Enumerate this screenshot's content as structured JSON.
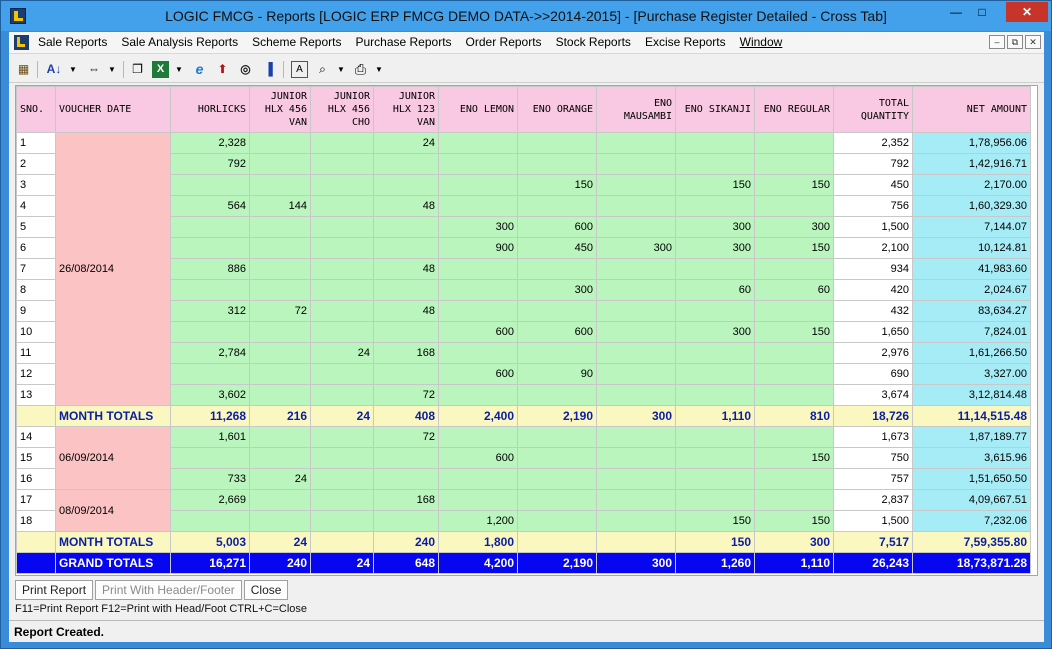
{
  "window": {
    "title": "LOGIC FMCG - Reports  [LOGIC ERP FMCG DEMO DATA->>2014-2015] - [Purchase Register Detailed - Cross Tab]",
    "min_glyph": "—",
    "max_glyph": "□",
    "close_glyph": "✕"
  },
  "menu": {
    "items": [
      "Sale Reports",
      "Sale Analysis Reports",
      "Scheme Reports",
      "Purchase Reports",
      "Order Reports",
      "Stock Reports",
      "Excise Reports",
      "Window"
    ],
    "mdi_min": "–",
    "mdi_restore": "⧉",
    "mdi_close": "✕"
  },
  "toolbar": {
    "icons": [
      "calendar-icon",
      "sort-icon",
      "column-width-icon",
      "copy-icon",
      "excel-icon",
      "internet-explorer-icon",
      "upload-arrow-icon",
      "binoculars-icon",
      "chart-icon",
      "font-icon",
      "print-preview-icon",
      "printer-icon"
    ],
    "glyphs": {
      "calendar": "▦",
      "sort": "A↓",
      "width": "⇔",
      "copy": "❐",
      "excel": "X",
      "ie": "e",
      "arrow": "⬆",
      "binoculars": "◎",
      "chart": "▐",
      "font": "A",
      "preview": "⌕",
      "printer": "⎙",
      "dropdown": "▼"
    }
  },
  "grid": {
    "columns": [
      "SNO.",
      "VOUCHER DATE",
      "HORLICKS",
      "JUNIOR HLX 456 VAN",
      "JUNIOR HLX 456 CHO",
      "JUNIOR HLX 123 VAN",
      "ENO LEMON",
      "ENO ORANGE",
      "ENO MAUSAMBI",
      "ENO SIKANJI",
      "ENO REGULAR",
      "TOTAL QUANTITY",
      "NET AMOUNT"
    ],
    "groups": [
      {
        "date": "26/08/2014",
        "rows": [
          {
            "sno": "1",
            "v": [
              "2,328",
              "",
              "",
              "24",
              "",
              "",
              "",
              "",
              ""
            ],
            "tq": "2,352",
            "na": "1,78,956.06"
          },
          {
            "sno": "2",
            "v": [
              "792",
              "",
              "",
              "",
              "",
              "",
              "",
              "",
              ""
            ],
            "tq": "792",
            "na": "1,42,916.71"
          },
          {
            "sno": "3",
            "v": [
              "",
              "",
              "",
              "",
              "",
              "150",
              "",
              "150",
              "150"
            ],
            "tq": "450",
            "na": "2,170.00"
          },
          {
            "sno": "4",
            "v": [
              "564",
              "144",
              "",
              "48",
              "",
              "",
              "",
              "",
              ""
            ],
            "tq": "756",
            "na": "1,60,329.30"
          },
          {
            "sno": "5",
            "v": [
              "",
              "",
              "",
              "",
              "300",
              "600",
              "",
              "300",
              "300"
            ],
            "tq": "1,500",
            "na": "7,144.07"
          },
          {
            "sno": "6",
            "v": [
              "",
              "",
              "",
              "",
              "900",
              "450",
              "300",
              "300",
              "150"
            ],
            "tq": "2,100",
            "na": "10,124.81"
          },
          {
            "sno": "7",
            "v": [
              "886",
              "",
              "",
              "48",
              "",
              "",
              "",
              "",
              ""
            ],
            "tq": "934",
            "na": "41,983.60"
          },
          {
            "sno": "8",
            "v": [
              "",
              "",
              "",
              "",
              "",
              "300",
              "",
              "60",
              "60"
            ],
            "tq": "420",
            "na": "2,024.67"
          },
          {
            "sno": "9",
            "v": [
              "312",
              "72",
              "",
              "48",
              "",
              "",
              "",
              "",
              ""
            ],
            "tq": "432",
            "na": "83,634.27"
          },
          {
            "sno": "10",
            "v": [
              "",
              "",
              "",
              "",
              "600",
              "600",
              "",
              "300",
              "150"
            ],
            "tq": "1,650",
            "na": "7,824.01"
          },
          {
            "sno": "11",
            "v": [
              "2,784",
              "",
              "24",
              "168",
              "",
              "",
              "",
              "",
              ""
            ],
            "tq": "2,976",
            "na": "1,61,266.50"
          },
          {
            "sno": "12",
            "v": [
              "",
              "",
              "",
              "",
              "600",
              "90",
              "",
              "",
              ""
            ],
            "tq": "690",
            "na": "3,327.00"
          },
          {
            "sno": "13",
            "v": [
              "3,602",
              "",
              "",
              "72",
              "",
              "",
              "",
              "",
              ""
            ],
            "tq": "3,674",
            "na": "3,12,814.48"
          }
        ],
        "totals": {
          "label": "MONTH TOTALS",
          "v": [
            "11,268",
            "216",
            "24",
            "408",
            "2,400",
            "2,190",
            "300",
            "1,110",
            "810"
          ],
          "tq": "18,726",
          "na": "11,14,515.48"
        }
      },
      {
        "date": "06/09/2014",
        "rows": [
          {
            "sno": "14",
            "v": [
              "1,601",
              "",
              "",
              "72",
              "",
              "",
              "",
              "",
              ""
            ],
            "tq": "1,673",
            "na": "1,87,189.77"
          },
          {
            "sno": "15",
            "v": [
              "",
              "",
              "",
              "",
              "600",
              "",
              "",
              "",
              "150"
            ],
            "tq": "750",
            "na": "3,615.96"
          },
          {
            "sno": "16",
            "v": [
              "733",
              "24",
              "",
              "",
              "",
              "",
              "",
              "",
              ""
            ],
            "tq": "757",
            "na": "1,51,650.50"
          }
        ]
      },
      {
        "date": "08/09/2014",
        "rows": [
          {
            "sno": "17",
            "v": [
              "2,669",
              "",
              "",
              "168",
              "",
              "",
              "",
              "",
              ""
            ],
            "tq": "2,837",
            "na": "4,09,667.51"
          },
          {
            "sno": "18",
            "v": [
              "",
              "",
              "",
              "",
              "1,200",
              "",
              "",
              "150",
              "150"
            ],
            "tq": "1,500",
            "na": "7,232.06"
          }
        ],
        "totals": {
          "label": "MONTH TOTALS",
          "v": [
            "5,003",
            "24",
            "",
            "240",
            "1,800",
            "",
            "",
            "150",
            "300"
          ],
          "tq": "7,517",
          "na": "7,59,355.80"
        }
      }
    ],
    "grand_totals": {
      "label": "GRAND TOTALS",
      "v": [
        "16,271",
        "240",
        "24",
        "648",
        "4,200",
        "2,190",
        "300",
        "1,260",
        "1,110"
      ],
      "tq": "26,243",
      "na": "18,73,871.28"
    }
  },
  "buttons": {
    "print_report": "Print Report",
    "print_header_footer": "Print With Header/Footer",
    "close": "Close"
  },
  "hint": "F11=Print Report  F12=Print with Head/Foot  CTRL+C=Close",
  "status": "Report Created."
}
